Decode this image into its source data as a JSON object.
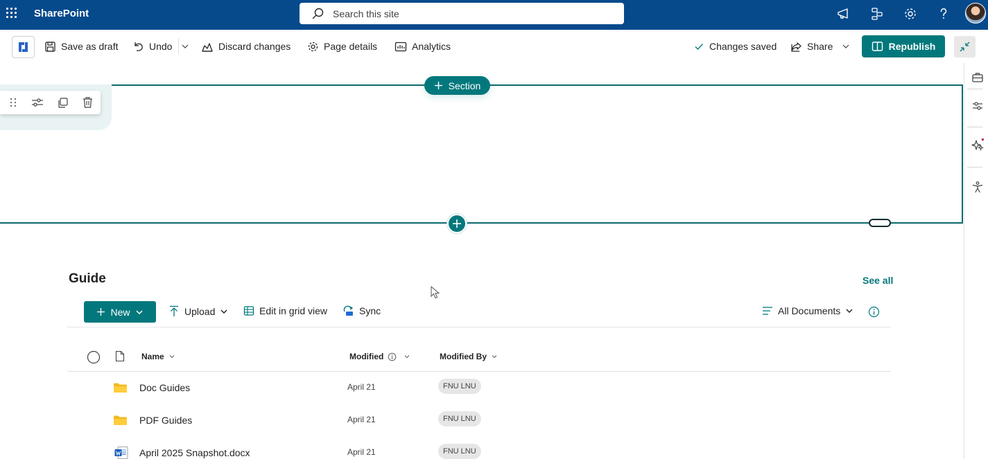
{
  "suite": {
    "app_name": "SharePoint",
    "search_placeholder": "Search this site"
  },
  "command_bar": {
    "save_draft": "Save as draft",
    "undo": "Undo",
    "discard": "Discard changes",
    "page_details": "Page details",
    "analytics": "Analytics",
    "status": "Changes saved",
    "share": "Share",
    "republish": "Republish"
  },
  "canvas": {
    "add_section_label": "Section"
  },
  "library": {
    "title": "Guide",
    "see_all": "See all",
    "toolbar": {
      "new": "New",
      "upload": "Upload",
      "edit_grid": "Edit in grid view",
      "sync": "Sync",
      "view": "All Documents"
    },
    "columns": {
      "name": "Name",
      "modified": "Modified",
      "modified_by": "Modified By"
    },
    "rows": [
      {
        "name": "Doc Guides",
        "modified": "April 21",
        "modified_by": "FNU LNU",
        "type": "folder"
      },
      {
        "name": "PDF Guides",
        "modified": "April 21",
        "modified_by": "FNU LNU",
        "type": "folder"
      },
      {
        "name": "April 2025 Snapshot.docx",
        "modified": "April 21",
        "modified_by": "FNU LNU",
        "type": "word"
      }
    ]
  },
  "colors": {
    "suite_bar": "#064a8c",
    "accent": "#03787c",
    "folder": "#f2b91f",
    "word": "#185abd"
  }
}
